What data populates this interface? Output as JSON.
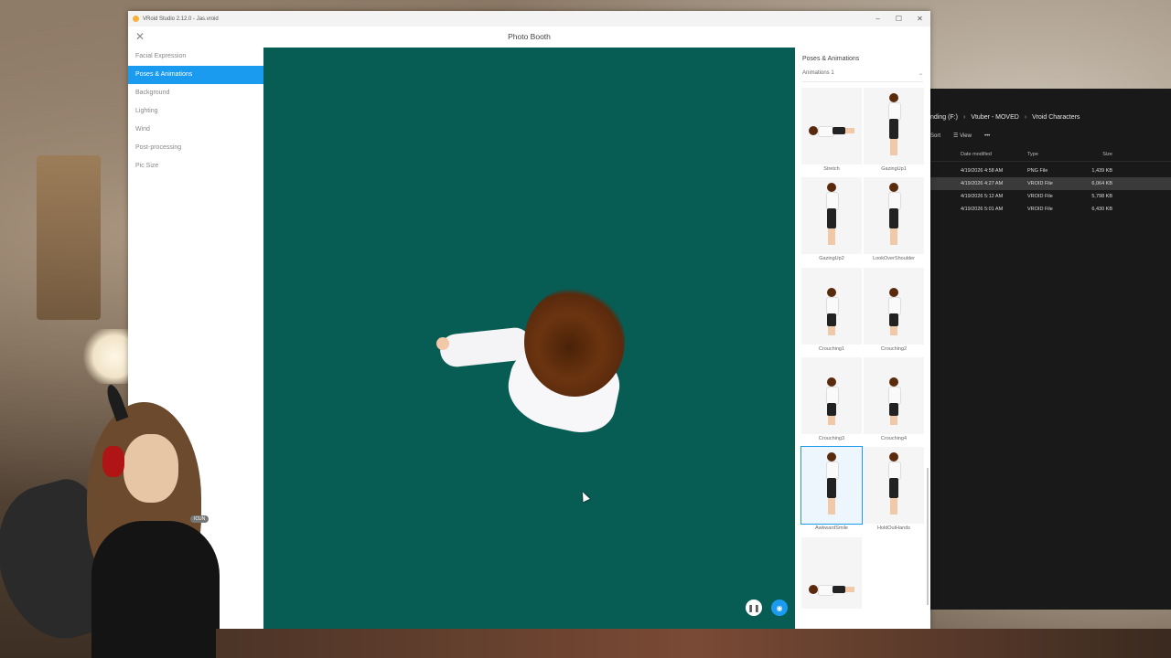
{
  "window": {
    "title": "VRoid Studio 2.12.0 - Jas.vroid",
    "controls": {
      "minimize": "–",
      "maximize": "☐",
      "close": "✕"
    }
  },
  "header": {
    "title": "Photo Booth",
    "close": "✕"
  },
  "sidebar": {
    "items": [
      {
        "label": "Facial Expression"
      },
      {
        "label": "Poses & Animations"
      },
      {
        "label": "Background"
      },
      {
        "label": "Lighting"
      },
      {
        "label": "Wind"
      },
      {
        "label": "Post-processing"
      },
      {
        "label": "Pic Size"
      }
    ],
    "active_index": 1
  },
  "right_panel": {
    "title": "Poses & Animations",
    "dropdown_value": "Animations 1",
    "dropdown_icon": "chevron-down-icon",
    "animations": [
      {
        "label": "Stretch"
      },
      {
        "label": "GazingUp1"
      },
      {
        "label": "GazingUp2"
      },
      {
        "label": "LookOverShoulder"
      },
      {
        "label": "Crouching1"
      },
      {
        "label": "Crouching2"
      },
      {
        "label": "Crouching3"
      },
      {
        "label": "Crouching4"
      },
      {
        "label": "AwkwardSmile"
      },
      {
        "label": "HoldOutHands"
      },
      {
        "label": ""
      }
    ],
    "selected_label": "AwkwardSmile"
  },
  "viewport": {
    "background_color": "#075c54",
    "pause_icon": "pause-icon",
    "camera_icon": "camera-icon"
  },
  "explorer": {
    "path": [
      "nding (F:)",
      "Vtuber - MOVED",
      "Vroid Characters"
    ],
    "toolbar": {
      "sort": "Sort",
      "view": "View",
      "more": "•••"
    },
    "columns": {
      "date": "Date modified",
      "type": "Type",
      "size": "Size"
    },
    "rows": [
      {
        "date": "4/19/2026 4:58 AM",
        "type": "PNG File",
        "size": "1,439 KB"
      },
      {
        "date": "4/19/2026 4:27 AM",
        "type": "VROID File",
        "size": "6,064 KB"
      },
      {
        "date": "4/19/2026 5:12 AM",
        "type": "VROID File",
        "size": "5,798 KB"
      },
      {
        "date": "4/19/2026 5:01 AM",
        "type": "VROID File",
        "size": "6,430 KB"
      }
    ],
    "selected_row": 1
  },
  "overlay": {
    "badge": "ICUN"
  },
  "colors": {
    "accent": "#1a9bf0",
    "viewport": "#075c54"
  }
}
